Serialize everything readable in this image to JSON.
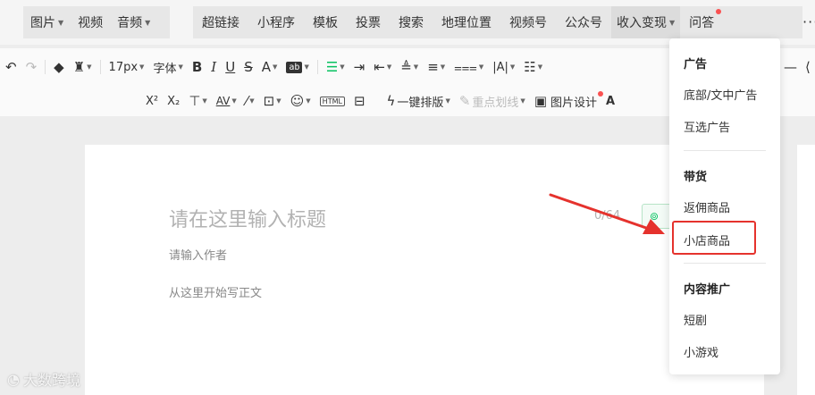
{
  "menubar": {
    "group1": [
      {
        "label": "图片",
        "caret": true
      },
      {
        "label": "视频",
        "caret": false
      },
      {
        "label": "音频",
        "caret": true
      }
    ],
    "group2": [
      {
        "label": "超链接",
        "caret": false
      },
      {
        "label": "小程序",
        "caret": false
      },
      {
        "label": "模板",
        "caret": false
      },
      {
        "label": "投票",
        "caret": false
      },
      {
        "label": "搜索",
        "caret": false
      },
      {
        "label": "地理位置",
        "caret": false
      },
      {
        "label": "视频号",
        "caret": false
      },
      {
        "label": "公众号",
        "caret": false
      },
      {
        "label": "收入变现",
        "caret": true
      },
      {
        "label": "问答",
        "caret": false
      }
    ],
    "more": "···"
  },
  "toolbar1": {
    "font_size": "17px",
    "font_family": "字体",
    "bold": "B",
    "italic": "I",
    "underline": "U",
    "strike": "S",
    "font_color": "A",
    "highlight": "ab",
    "letter_spacing": "|A|"
  },
  "toolbar2": {
    "superscript": "X²",
    "subscript": "X₂",
    "av": "AV",
    "html": "HTML",
    "one_click_layout": "一键排版",
    "key_underline": "重点划线",
    "image_design": "图片设计",
    "ai": "A"
  },
  "editor": {
    "title_placeholder": "请在这里输入标题",
    "title_count": "0/64",
    "author_placeholder": "请输入作者",
    "body_placeholder": "从这里开始写正文"
  },
  "dropdown": {
    "section_ads": "广告",
    "item_bottom_ad": "底部/文中广告",
    "item_mutual_ad": "互选广告",
    "section_goods": "带货",
    "item_commission": "返佣商品",
    "item_shop": "小店商品",
    "section_promo": "内容推广",
    "item_drama": "短剧",
    "item_game": "小游戏"
  },
  "watermark": "大数跨境",
  "colors": {
    "accent_green": "#07c160",
    "highlight_red": "#e5322d",
    "badge_red": "#fa5151"
  }
}
